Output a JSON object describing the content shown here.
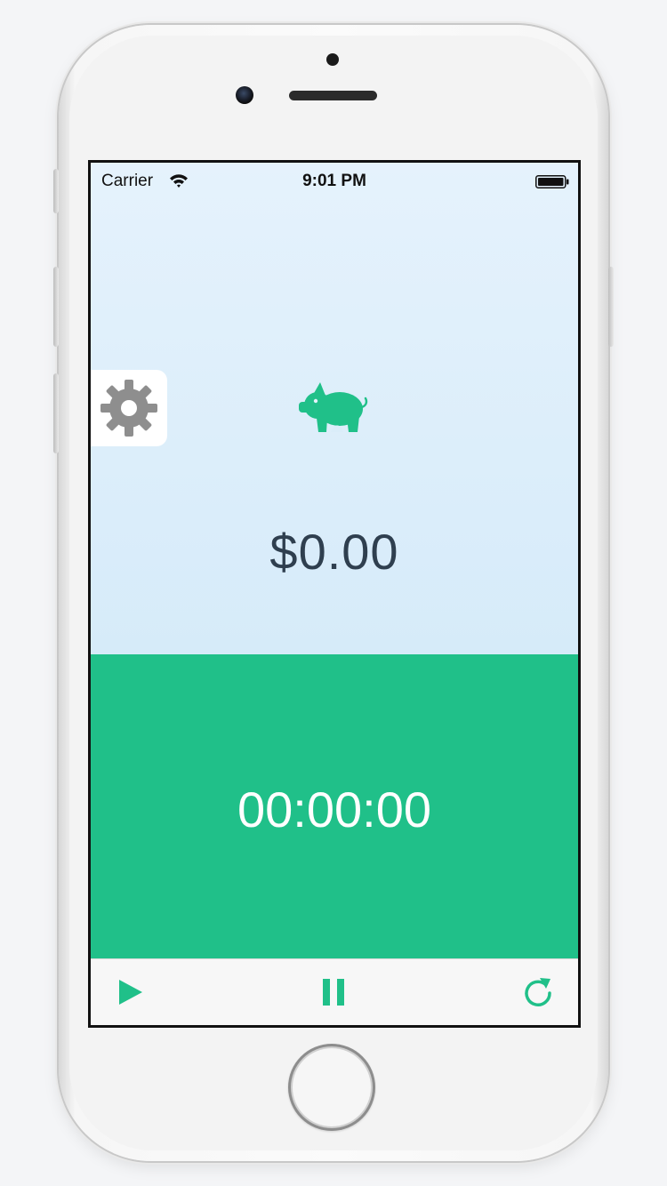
{
  "status_bar": {
    "carrier": "Carrier",
    "time": "9:01 PM",
    "wifi_icon": "wifi-icon",
    "battery_icon": "battery-icon"
  },
  "header": {
    "settings_icon": "gear-icon",
    "logo_icon": "piggy-icon"
  },
  "main": {
    "amount": "$0.00",
    "timer": "00:00:00"
  },
  "toolbar": {
    "play_icon": "play-icon",
    "pause_icon": "pause-icon",
    "reset_icon": "reset-icon"
  },
  "colors": {
    "accent": "#20c089",
    "top_background": "#d6ebf9",
    "amount_text": "#2f3f4f",
    "settings_gear": "#8e8e8e"
  }
}
